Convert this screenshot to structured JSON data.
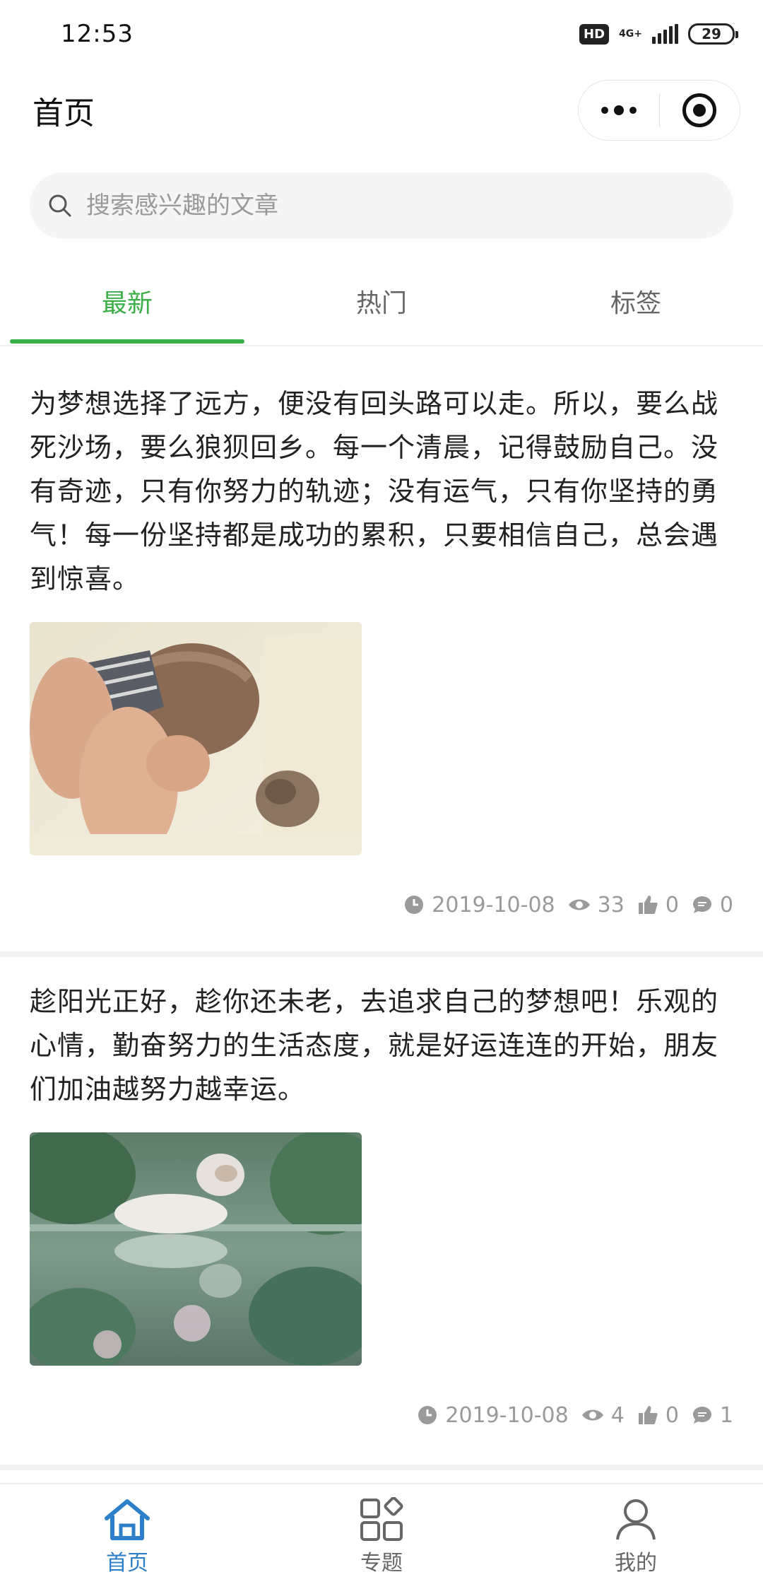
{
  "status_bar": {
    "time": "12:53",
    "hd": "HD",
    "network": "4G+",
    "battery": "29"
  },
  "nav": {
    "title": "首页"
  },
  "search": {
    "placeholder": "搜索感兴趣的文章"
  },
  "tabs": [
    {
      "label": "最新",
      "active": true
    },
    {
      "label": "热门",
      "active": false
    },
    {
      "label": "标签",
      "active": false
    }
  ],
  "articles": [
    {
      "text": "为梦想选择了远方，便没有回头路可以走。所以，要么战死沙场，要么狼狈回乡。每一个清晨，记得鼓励自己。没有奇迹，只有你努力的轨迹；没有运气，只有你坚持的勇气！每一份坚持都是成功的累积，只要相信自己，总会遇到惊喜。",
      "image": "girl-with-kitten-photo",
      "date": "2019-10-08",
      "views": "33",
      "likes": "0",
      "comments": "0"
    },
    {
      "text": "趁阳光正好，趁你还未老，去追求自己的梦想吧！乐观的心情，勤奋努力的生活态度，就是好运连连的开始，朋友们加油越努力越幸运。",
      "image": "cat-reflection-photo",
      "date": "2019-10-08",
      "views": "4",
      "likes": "0",
      "comments": "1"
    }
  ],
  "tabbar": [
    {
      "label": "首页",
      "icon": "home-icon",
      "active": true
    },
    {
      "label": "专题",
      "icon": "grid-icon",
      "active": false
    },
    {
      "label": "我的",
      "icon": "user-icon",
      "active": false
    }
  ],
  "colors": {
    "accent_green": "#3aae47",
    "tabbar_active": "#2e7fc9",
    "meta_gray": "#9a9a9a"
  }
}
